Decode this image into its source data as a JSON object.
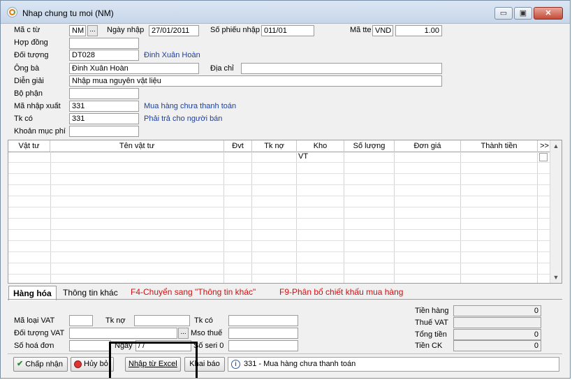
{
  "window": {
    "title": "Nhap chung tu moi (NM)",
    "minimize": "▭",
    "maximize": "▣",
    "close": "✕"
  },
  "header": {
    "ma_ct_label": "Mã c từ",
    "ma_ct_value": "NM",
    "ma_ct_browse": "...",
    "ngay_nhap_label": "Ngày nhập",
    "ngay_nhap_value": "27/01/2011",
    "so_phieu_label": "Số phiếu nhập",
    "so_phieu_value": "011/01",
    "ma_tte_label": "Mã tte",
    "ma_tte_value": "VND",
    "ty_gia_value": "1.00",
    "hop_dong_label": "Hợp đồng",
    "hop_dong_value": "",
    "doi_tuong_label": "Đối tượng",
    "doi_tuong_value": "DT028",
    "doi_tuong_name": "Đinh Xuân Hoàn",
    "ong_ba_label": "Ông bà",
    "ong_ba_value": "Đinh Xuân Hoàn",
    "dia_chi_label": "Địa chỉ",
    "dia_chi_value": "",
    "dien_giai_label": "Diễn giải",
    "dien_giai_value": "Nhập mua nguyên vật liệu",
    "bo_phan_label": "Bộ phận",
    "bo_phan_value": "",
    "ma_nx_label": "Mã nhập xuất",
    "ma_nx_value": "331",
    "ma_nx_desc": "Mua hàng chưa thanh toán",
    "tk_co_label": "Tk có",
    "tk_co_value": "331",
    "tk_co_desc": "Phải trả cho người bán",
    "khoan_muc_label": "Khoản mục phí",
    "khoan_muc_value": ""
  },
  "grid": {
    "columns": [
      "Vật tư",
      "Tên vật tư",
      "Đvt",
      "Tk nợ",
      "Kho",
      "Số lượng",
      "Đơn giá",
      "Thành tiền",
      ">>"
    ],
    "first_row_kho": "VT",
    "scroll_up": "▲",
    "scroll_down": "▼"
  },
  "tabs": {
    "hang_hoa": "Hàng hóa",
    "thong_tin_khac": "Thông tin khác",
    "hint_f4": "F4-Chuyển sang \"Thông tin khác\"",
    "hint_f9": "F9-Phân bổ chiết khấu mua hàng"
  },
  "vat": {
    "ma_loai_vat_label": "Mã loại VAT",
    "ma_loai_vat_value": "",
    "tk_no_label": "Tk nợ",
    "tk_no_value": "",
    "tk_co_label": "Tk có",
    "tk_co_value": "",
    "doi_tuong_vat_label": "Đối tượng VAT",
    "doi_tuong_vat_value": "",
    "browse": "...",
    "mso_thue_label": "Mso thuế",
    "mso_thue_value": "",
    "so_hoa_don_label": "Số hoá đơn",
    "so_hoa_don_value": "",
    "ngay_label": "Ngày",
    "ngay_value": " / /",
    "so_seri_label": "Số seri 0",
    "so_seri_value": ""
  },
  "totals": {
    "tien_hang_label": "Tiền hàng",
    "tien_hang_value": "0",
    "thue_vat_label": "Thuế VAT",
    "thue_vat_value": "",
    "tong_tien_label": "Tổng tiền",
    "tong_tien_value": "0",
    "tien_ck_label": "Tiền CK",
    "tien_ck_value": "0"
  },
  "buttons": {
    "chap_nhan": "Chấp nhận",
    "huy_bo": "Hủy bỏ",
    "nhap_excel": "Nhập từ Excel",
    "khai_bao": "Khai báo"
  },
  "status": {
    "text": "331 - Mua hàng chưa thanh toán"
  }
}
